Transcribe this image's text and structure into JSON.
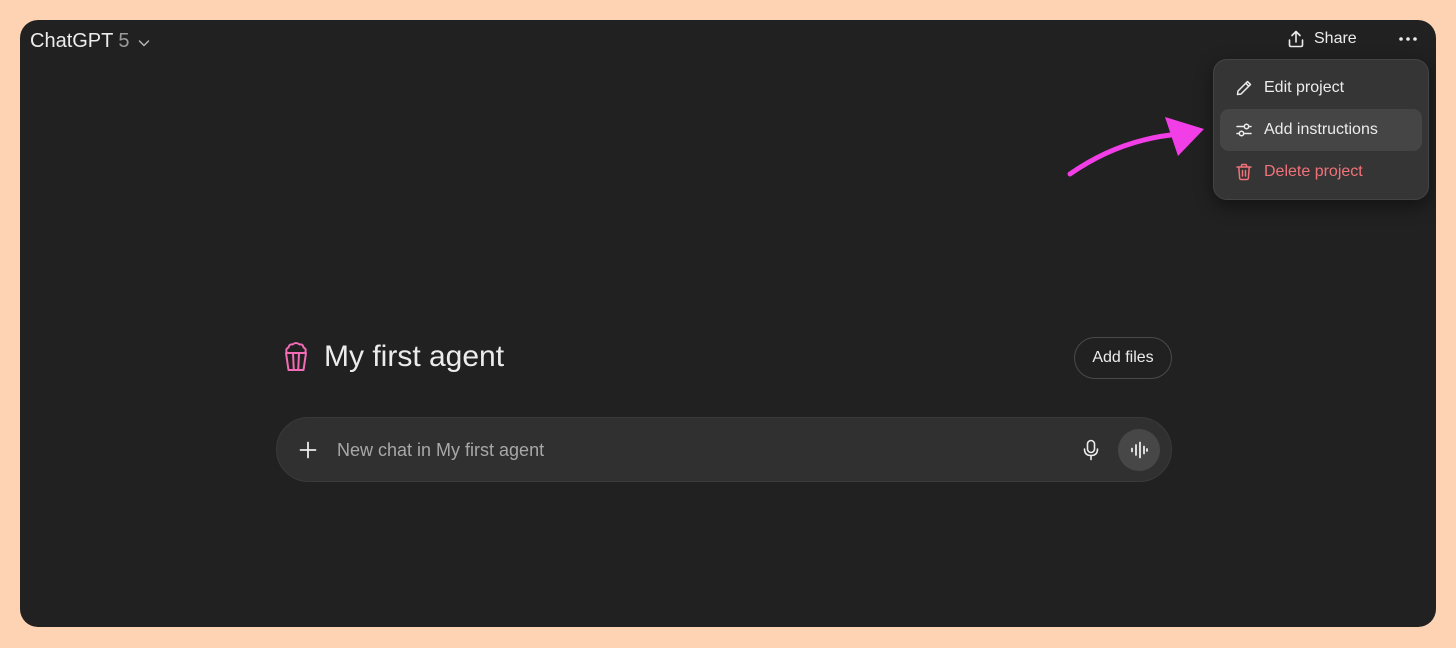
{
  "header": {
    "model_name": "ChatGPT",
    "model_version": "5",
    "share_label": "Share",
    "icons": {
      "model_chevron": "chevron-down-icon",
      "share": "share-icon",
      "more": "more-horizontal-icon"
    }
  },
  "menu": {
    "items": [
      {
        "label": "Edit project",
        "icon": "pencil-icon",
        "state": "normal"
      },
      {
        "label": "Add instructions",
        "icon": "sliders-icon",
        "state": "hovered"
      },
      {
        "label": "Delete project",
        "icon": "trash-icon",
        "state": "danger"
      }
    ]
  },
  "annotation": {
    "arrow_color": "#f23ee6",
    "points_to": "Add instructions"
  },
  "project": {
    "title": "My first agent",
    "icon": "popcorn-icon",
    "icon_color": "#f26bb5",
    "add_files_label": "Add files"
  },
  "composer": {
    "placeholder": "New chat in My first agent",
    "value": "",
    "icons": {
      "plus": "plus-icon",
      "mic": "microphone-icon",
      "voice": "voice-waveform-icon"
    }
  },
  "colors": {
    "background": "#212121",
    "frame": "#fdd3b4",
    "danger": "#f2727a"
  }
}
